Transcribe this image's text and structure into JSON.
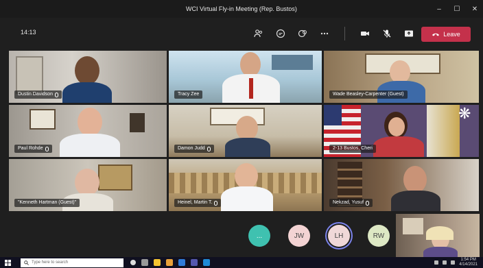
{
  "window": {
    "title": "WCI Virtual Fly-in Meeting (Rep. Bustos)",
    "controls": [
      "–",
      "☐",
      "✕"
    ]
  },
  "toolbar": {
    "timer": "14:13",
    "icons": [
      "participants-icon",
      "chat-icon",
      "reactions-icon",
      "more-icon",
      "camera-icon",
      "mic-off-icon",
      "share-icon"
    ],
    "leave_label": "Leave",
    "leave_color": "#c4314b"
  },
  "participants": [
    {
      "name": "Dustin Davidson",
      "muted": true
    },
    {
      "name": "Tracy Zee",
      "muted": false
    },
    {
      "name": "Wade Beasley-Carpenter (Guest)",
      "muted": false
    },
    {
      "name": "Paul Rohde",
      "muted": true
    },
    {
      "name": "Damon Judd",
      "muted": true
    },
    {
      "name": "2-13 Bustos, Cheri",
      "muted": false
    },
    {
      "name": "\"Kenneth Hartman (Guest)\"",
      "muted": false
    },
    {
      "name": "Heinel, Martin T.",
      "muted": true
    },
    {
      "name": "Nekzad, Yusuf",
      "muted": true
    }
  ],
  "avatars": [
    {
      "initials": "...",
      "color": "#3fc1b0",
      "active": false
    },
    {
      "initials": "JW",
      "color": "#f3d3d3",
      "active": false
    },
    {
      "initials": "LH",
      "color": "#f0d8d8",
      "active": true
    },
    {
      "initials": "RW",
      "color": "#dde8c4",
      "active": false
    }
  ],
  "taskbar": {
    "search_placeholder": "Type here to search",
    "clock_time": "1:54 PM",
    "clock_date": "4/14/2021"
  }
}
